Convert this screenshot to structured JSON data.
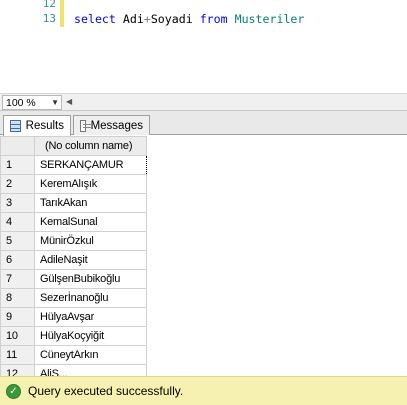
{
  "editor": {
    "lines": [
      {
        "number": "12",
        "text": ""
      },
      {
        "number": "13",
        "kw1": "select",
        "ident1": "Adi",
        "op": "+",
        "ident2": "Soyadi",
        "kw2": "from",
        "ident3": "Musteriler"
      }
    ]
  },
  "zoom": {
    "value": "100 %"
  },
  "tabs": {
    "results": "Results",
    "messages": "Messages"
  },
  "grid": {
    "column": "(No column name)",
    "rows": [
      {
        "n": "1",
        "v": "SERKANÇAMUR"
      },
      {
        "n": "2",
        "v": "KeremAlışık"
      },
      {
        "n": "3",
        "v": "TarıkAkan"
      },
      {
        "n": "4",
        "v": "KemalSunal"
      },
      {
        "n": "5",
        "v": "MünirÖzkul"
      },
      {
        "n": "6",
        "v": "AdileNaşit"
      },
      {
        "n": "7",
        "v": "GülşenBubikoğlu"
      },
      {
        "n": "8",
        "v": "Sezerİnanoğlu"
      },
      {
        "n": "9",
        "v": "HülyaAvşar"
      },
      {
        "n": "10",
        "v": "HülyaKoçyiğit"
      },
      {
        "n": "11",
        "v": "CüneytArkın"
      },
      {
        "n": "12",
        "v": "AliS..."
      }
    ]
  },
  "status": {
    "text": "Query executed successfully.",
    "icon": "success-check-icon"
  }
}
